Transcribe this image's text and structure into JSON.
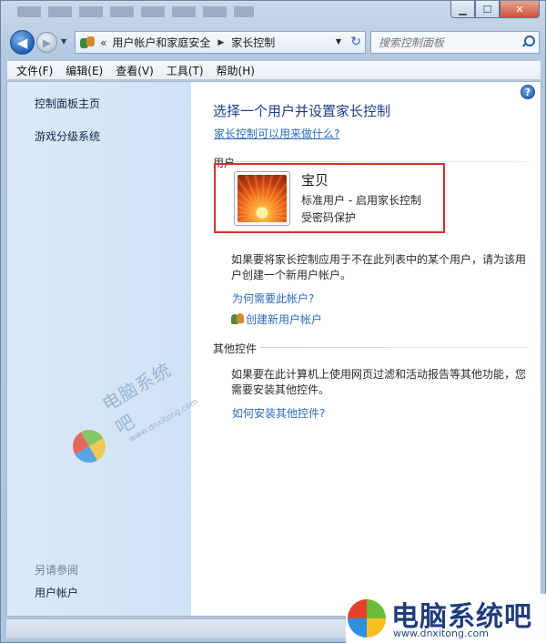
{
  "window": {
    "title": "",
    "caption_buttons": {
      "minimize": "▁",
      "maximize": "☐",
      "close": "✕"
    }
  },
  "nav": {
    "back_icon": "back-arrow-icon",
    "forward_icon": "forward-arrow-icon",
    "address_overflow": "«",
    "breadcrumbs": [
      "用户帐户和家庭安全",
      "家长控制"
    ],
    "search_placeholder": "搜索控制面板"
  },
  "menu": [
    "文件(F)",
    "编辑(E)",
    "查看(V)",
    "工具(T)",
    "帮助(H)"
  ],
  "sidebar": {
    "links": [
      "控制面板主页",
      "游戏分级系统"
    ],
    "see_also_title": "另请参阅",
    "see_also_links": [
      "用户帐户"
    ]
  },
  "main": {
    "title": "选择一个用户并设置家长控制",
    "what_can_do_link": "家长控制可以用来做什么?",
    "users_section_label": "用户",
    "user": {
      "name": "宝贝",
      "type": "标准用户 - 启用家长控制",
      "protection": "受密码保护"
    },
    "add_user_text": "如果要将家长控制应用于不在此列表中的某个用户，请为该用户创建一个新用户帐户。",
    "why_account_link": "为何需要此帐户?",
    "create_account_link": "创建新用户帐户",
    "other_controls_label": "其他控件",
    "other_controls_text": "如果要在此计算机上使用网页过滤和活动报告等其他功能，您需要安装其他控件。",
    "how_install_link": "如何安装其他控件?"
  },
  "watermark": {
    "text_cn": "电脑系统吧",
    "text_en": "www.dnxitong.com"
  },
  "corner_logo": {
    "text_cn": "电脑系统吧",
    "text_en": "www.dnxitong.com"
  },
  "colors": {
    "logo_red": "#e8402e",
    "logo_green": "#6dbb3a",
    "logo_blue": "#2f8ee0",
    "logo_yellow": "#f5bf1f",
    "highlight_border": "#d2302f"
  }
}
